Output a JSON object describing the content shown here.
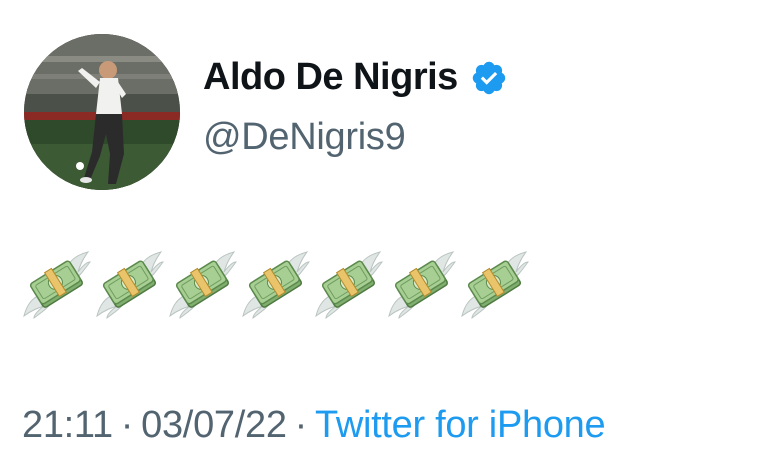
{
  "author": {
    "display_name": "Aldo De Nigris",
    "handle": "@DeNigris9",
    "verified": true,
    "avatar": "avatar-photo"
  },
  "tweet": {
    "emojis": [
      "money-with-wings-icon",
      "money-with-wings-icon",
      "money-with-wings-icon",
      "money-with-wings-icon",
      "money-with-wings-icon",
      "money-with-wings-icon",
      "money-with-wings-icon"
    ]
  },
  "meta": {
    "time": "21:11",
    "separator": "·",
    "date": "03/07/22",
    "source": "Twitter for iPhone"
  },
  "colors": {
    "verified": "#1d9bf0",
    "link": "#1d9bf0",
    "muted": "#536471",
    "text": "#0f1419"
  }
}
